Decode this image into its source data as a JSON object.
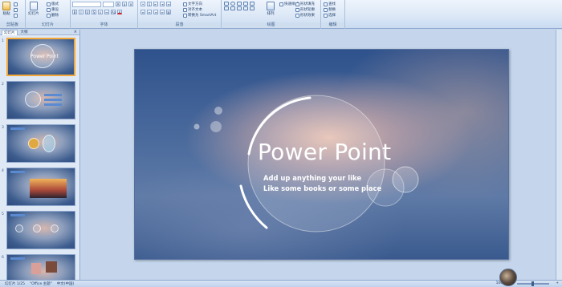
{
  "ribbon": {
    "groups": [
      {
        "label": "剪贴板"
      },
      {
        "label": "幻灯片"
      },
      {
        "label": "字体"
      },
      {
        "label": "段落"
      },
      {
        "label": "绘图"
      },
      {
        "label": "编辑"
      }
    ],
    "clipboard": {
      "paste": "粘贴"
    },
    "slides": {
      "new_slide": "幻灯片",
      "layout": "版式",
      "reset": "重设",
      "delete": "删除"
    },
    "paragraph": {
      "text_direction": "文字方向",
      "align_text": "对齐文本",
      "smartart": "转换为 SmartArt"
    },
    "drawing": {
      "arrange": "排列",
      "quick_styles": "快速样式",
      "shape_fill": "形状填充",
      "shape_outline": "形状轮廓",
      "shape_effects": "形状效果"
    },
    "editing": {
      "find": "查找",
      "replace": "替换",
      "select": "选择"
    }
  },
  "panel": {
    "tabs": [
      "幻灯片",
      "大纲"
    ],
    "close": "×",
    "slide_numbers": [
      "1",
      "2",
      "3",
      "4",
      "5",
      "6"
    ],
    "thumb1_title": "Power Point"
  },
  "slide": {
    "title": "Power Point",
    "subtitle_lines": [
      "Add up anything your like",
      "Like some books or some place"
    ]
  },
  "status": {
    "slide_count": "幻灯片 1/25",
    "theme": "\"Office 主题\"",
    "language": "中文(中国)",
    "zoom": "100%"
  },
  "colors": {
    "accent": "#f2a93a",
    "slide_base": "#2b4a82"
  }
}
